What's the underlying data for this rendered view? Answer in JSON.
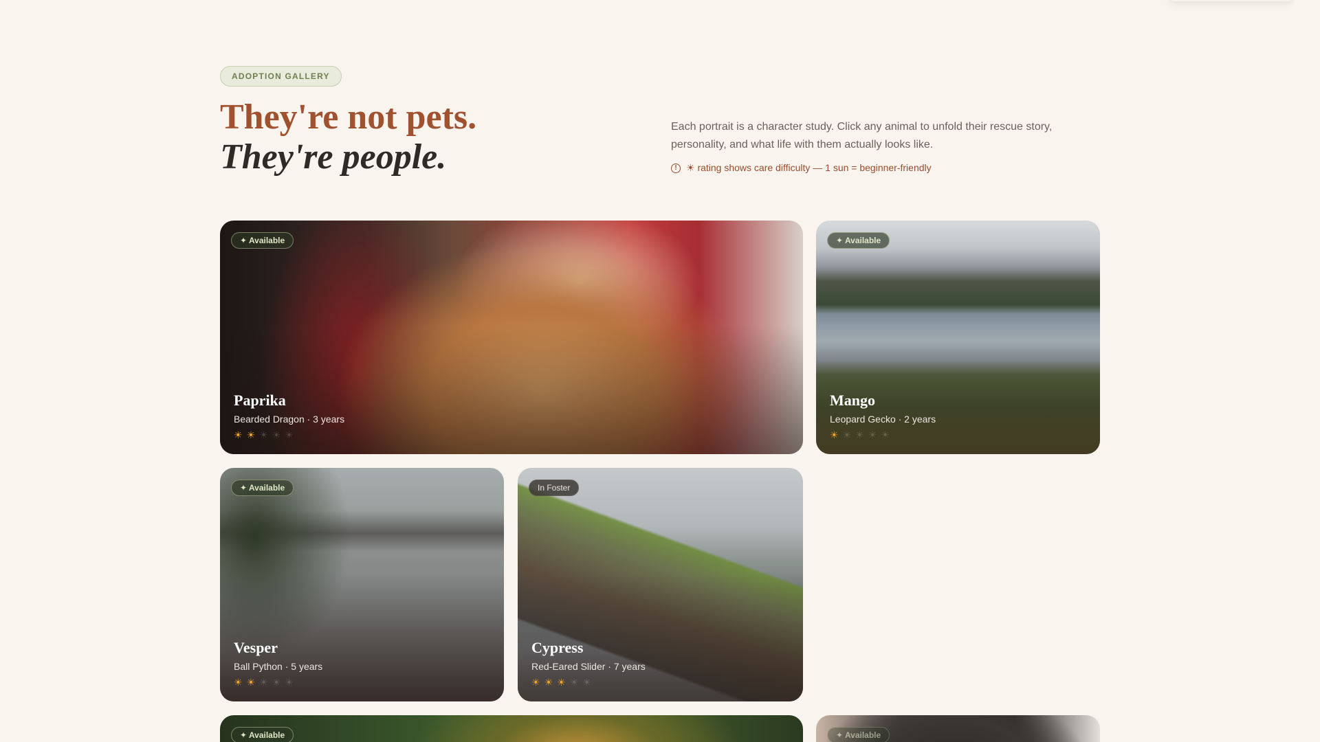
{
  "header": {
    "eyebrow": "ADOPTION GALLERY",
    "title_line1": "They're not pets.",
    "title_line2": "They're people.",
    "intro": "Each portrait is a character study. Click any animal to unfold their rescue story, personality, and what life with them actually looks like.",
    "legend": "☀ rating shows care difficulty — 1 sun = beginner-friendly",
    "legend_icon": "info-icon"
  },
  "colors": {
    "background": "#f9f5ee",
    "accent_terracotta": "#a0512f",
    "badge_green": "#6f7f4f",
    "sun_gold": "#f0a52a"
  },
  "cards": [
    {
      "status": "✦ Available",
      "status_type": "available",
      "name": "Paprika",
      "meta": "Bearded Dragon · 3 years",
      "difficulty": 2,
      "difficulty_max": 5
    },
    {
      "status": "✦ Available",
      "status_type": "available",
      "name": "Mango",
      "meta": "Leopard Gecko · 2 years",
      "difficulty": 1,
      "difficulty_max": 5
    },
    {
      "status": "✦ Available",
      "status_type": "available",
      "name": "Vesper",
      "meta": "Ball Python · 5 years",
      "difficulty": 2,
      "difficulty_max": 5
    },
    {
      "status": "In Foster",
      "status_type": "foster",
      "name": "Cypress",
      "meta": "Red-Eared Slider · 7 years",
      "difficulty": 3,
      "difficulty_max": 5
    },
    {
      "status": "✦ Available",
      "status_type": "available"
    },
    {
      "status": "✦ Available",
      "status_type": "available"
    }
  ]
}
